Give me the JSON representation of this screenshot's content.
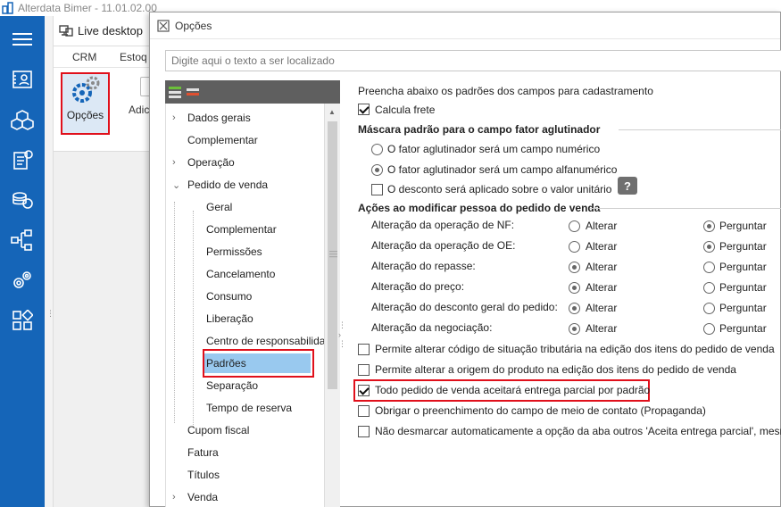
{
  "app": {
    "title": "Alterdata Bimer - 11.01.02.00"
  },
  "background": {
    "tab_label": "Live desktop",
    "menu": [
      "CRM",
      "Estoq"
    ],
    "opcoes_label": "Opções",
    "adic_label": "Adic"
  },
  "dialog": {
    "title": "Opções",
    "search_placeholder": "Digite aqui o texto a ser localizado",
    "tree": [
      "Dados gerais",
      "Complementar",
      "Operação",
      "Pedido de venda",
      "Geral",
      "Complementar",
      "Permissões",
      "Cancelamento",
      "Consumo",
      "Liberação",
      "Centro de responsabilida",
      "Padrões",
      "Separação",
      "Tempo de reserva",
      "Cupom fiscal",
      "Fatura",
      "Títulos",
      "Venda"
    ],
    "selected_tree_item": "Padrões",
    "intro": "Preencha abaixo os padrões dos campos para cadastramento",
    "calcula_frete": "Calcula frete",
    "mascara_title": "Máscara padrão para o campo fator aglutinador",
    "mascara_options": [
      "O fator aglutinador será um campo numérico",
      "O fator aglutinador será um campo alfanumérico"
    ],
    "mascara_selected": 1,
    "desconto_unitario": "O desconto será aplicado sobre o valor unitário",
    "acoes_title": "Ações ao modificar pessoa do pedido de venda",
    "option_alterar": "Alterar",
    "option_perguntar": "Perguntar",
    "acoes": [
      {
        "label": "Alteração da operação de NF:",
        "selected": "perguntar"
      },
      {
        "label": "Alteração da operação de OE:",
        "selected": "perguntar"
      },
      {
        "label": "Alteração do repasse:",
        "selected": "alterar"
      },
      {
        "label": "Alteração do preço:",
        "selected": "alterar"
      },
      {
        "label": "Alteração do desconto geral do pedido:",
        "selected": "alterar"
      },
      {
        "label": "Alteração da negociação:",
        "selected": "alterar"
      }
    ],
    "checks": [
      {
        "label": "Permite alterar código de situação tributária na edição dos itens do pedido de venda",
        "checked": false
      },
      {
        "label": "Permite alterar a origem do produto na edição dos itens do pedido de venda",
        "checked": false
      },
      {
        "label": "Todo pedido de venda aceitará entrega parcial por padrão",
        "checked": true
      },
      {
        "label": "Obrigar o preenchimento do campo de meio de contato (Propaganda)",
        "checked": false
      },
      {
        "label": "Não desmarcar automaticamente a opção da aba outros 'Aceita entrega parcial', mesm",
        "checked": false
      }
    ],
    "help_glyph": "?"
  },
  "colors": {
    "sidebar": "#1565b8",
    "highlight": "#e0101b",
    "selection": "#99c9ef"
  }
}
